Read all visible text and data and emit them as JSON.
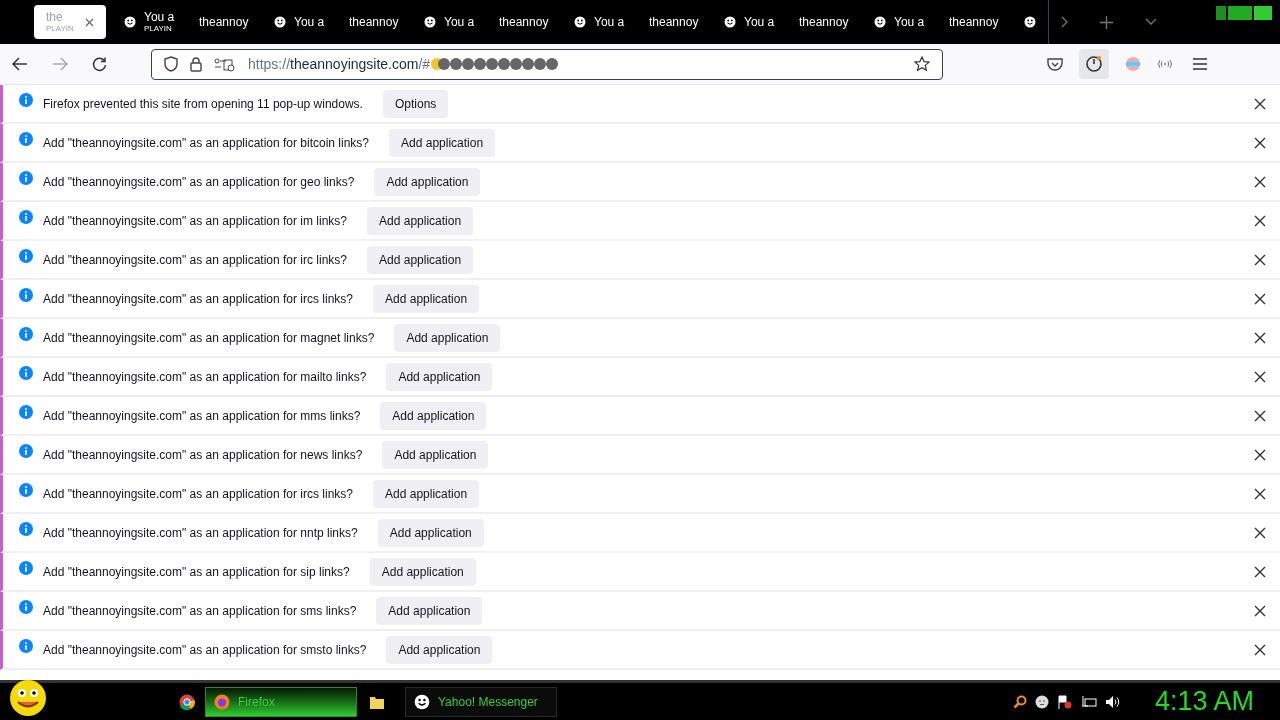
{
  "tabs": [
    {
      "label": "the",
      "sublabel": "PLAYIN",
      "selected": true,
      "kind": "page"
    },
    {
      "label": "You a",
      "sublabel": "PLAYIN",
      "selected": false,
      "kind": "smiley"
    },
    {
      "label": "theannoy",
      "selected": false,
      "kind": "page"
    },
    {
      "label": "You a",
      "selected": false,
      "kind": "smiley"
    },
    {
      "label": "theannoy",
      "selected": false,
      "kind": "page"
    },
    {
      "label": "You a",
      "selected": false,
      "kind": "smiley"
    },
    {
      "label": "theannoy",
      "selected": false,
      "kind": "page"
    },
    {
      "label": "You a",
      "selected": false,
      "kind": "smiley"
    },
    {
      "label": "theannoy",
      "selected": false,
      "kind": "page"
    },
    {
      "label": "You a",
      "selected": false,
      "kind": "smiley"
    },
    {
      "label": "theannoy",
      "selected": false,
      "kind": "page"
    },
    {
      "label": "You a",
      "selected": false,
      "kind": "smiley"
    },
    {
      "label": "theannoy",
      "selected": false,
      "kind": "page"
    },
    {
      "selected": false,
      "kind": "smiley"
    }
  ],
  "address_bar": {
    "scheme": "https://",
    "host": "theannoyingsite.com",
    "path": "/#"
  },
  "notifications": [
    {
      "message": "Firefox prevented this site from opening 11 pop-up windows.",
      "button": "Options"
    },
    {
      "message": "Add \"theannoyingsite.com\" as an application for bitcoin links?",
      "button": "Add application"
    },
    {
      "message": "Add \"theannoyingsite.com\" as an application for geo links?",
      "button": "Add application"
    },
    {
      "message": "Add \"theannoyingsite.com\" as an application for im links?",
      "button": "Add application"
    },
    {
      "message": "Add \"theannoyingsite.com\" as an application for irc links?",
      "button": "Add application"
    },
    {
      "message": "Add \"theannoyingsite.com\" as an application for ircs links?",
      "button": "Add application"
    },
    {
      "message": "Add \"theannoyingsite.com\" as an application for magnet links?",
      "button": "Add application"
    },
    {
      "message": "Add \"theannoyingsite.com\" as an application for mailto links?",
      "button": "Add application"
    },
    {
      "message": "Add \"theannoyingsite.com\" as an application for mms links?",
      "button": "Add application"
    },
    {
      "message": "Add \"theannoyingsite.com\" as an application for news links?",
      "button": "Add application"
    },
    {
      "message": "Add \"theannoyingsite.com\" as an application for ircs links?",
      "button": "Add application"
    },
    {
      "message": "Add \"theannoyingsite.com\" as an application for nntp links?",
      "button": "Add application"
    },
    {
      "message": "Add \"theannoyingsite.com\" as an application for sip links?",
      "button": "Add application"
    },
    {
      "message": "Add \"theannoyingsite.com\" as an application for sms links?",
      "button": "Add application"
    },
    {
      "message": "Add \"theannoyingsite.com\" as an application for smsto links?",
      "button": "Add application"
    }
  ],
  "taskbar": {
    "buttons": [
      {
        "label": "Firefox",
        "selected": true,
        "kind": "firefox"
      },
      {
        "label": "Yahoo! Messenger",
        "selected": false,
        "kind": "messenger"
      }
    ],
    "clock": "4:13 AM"
  }
}
